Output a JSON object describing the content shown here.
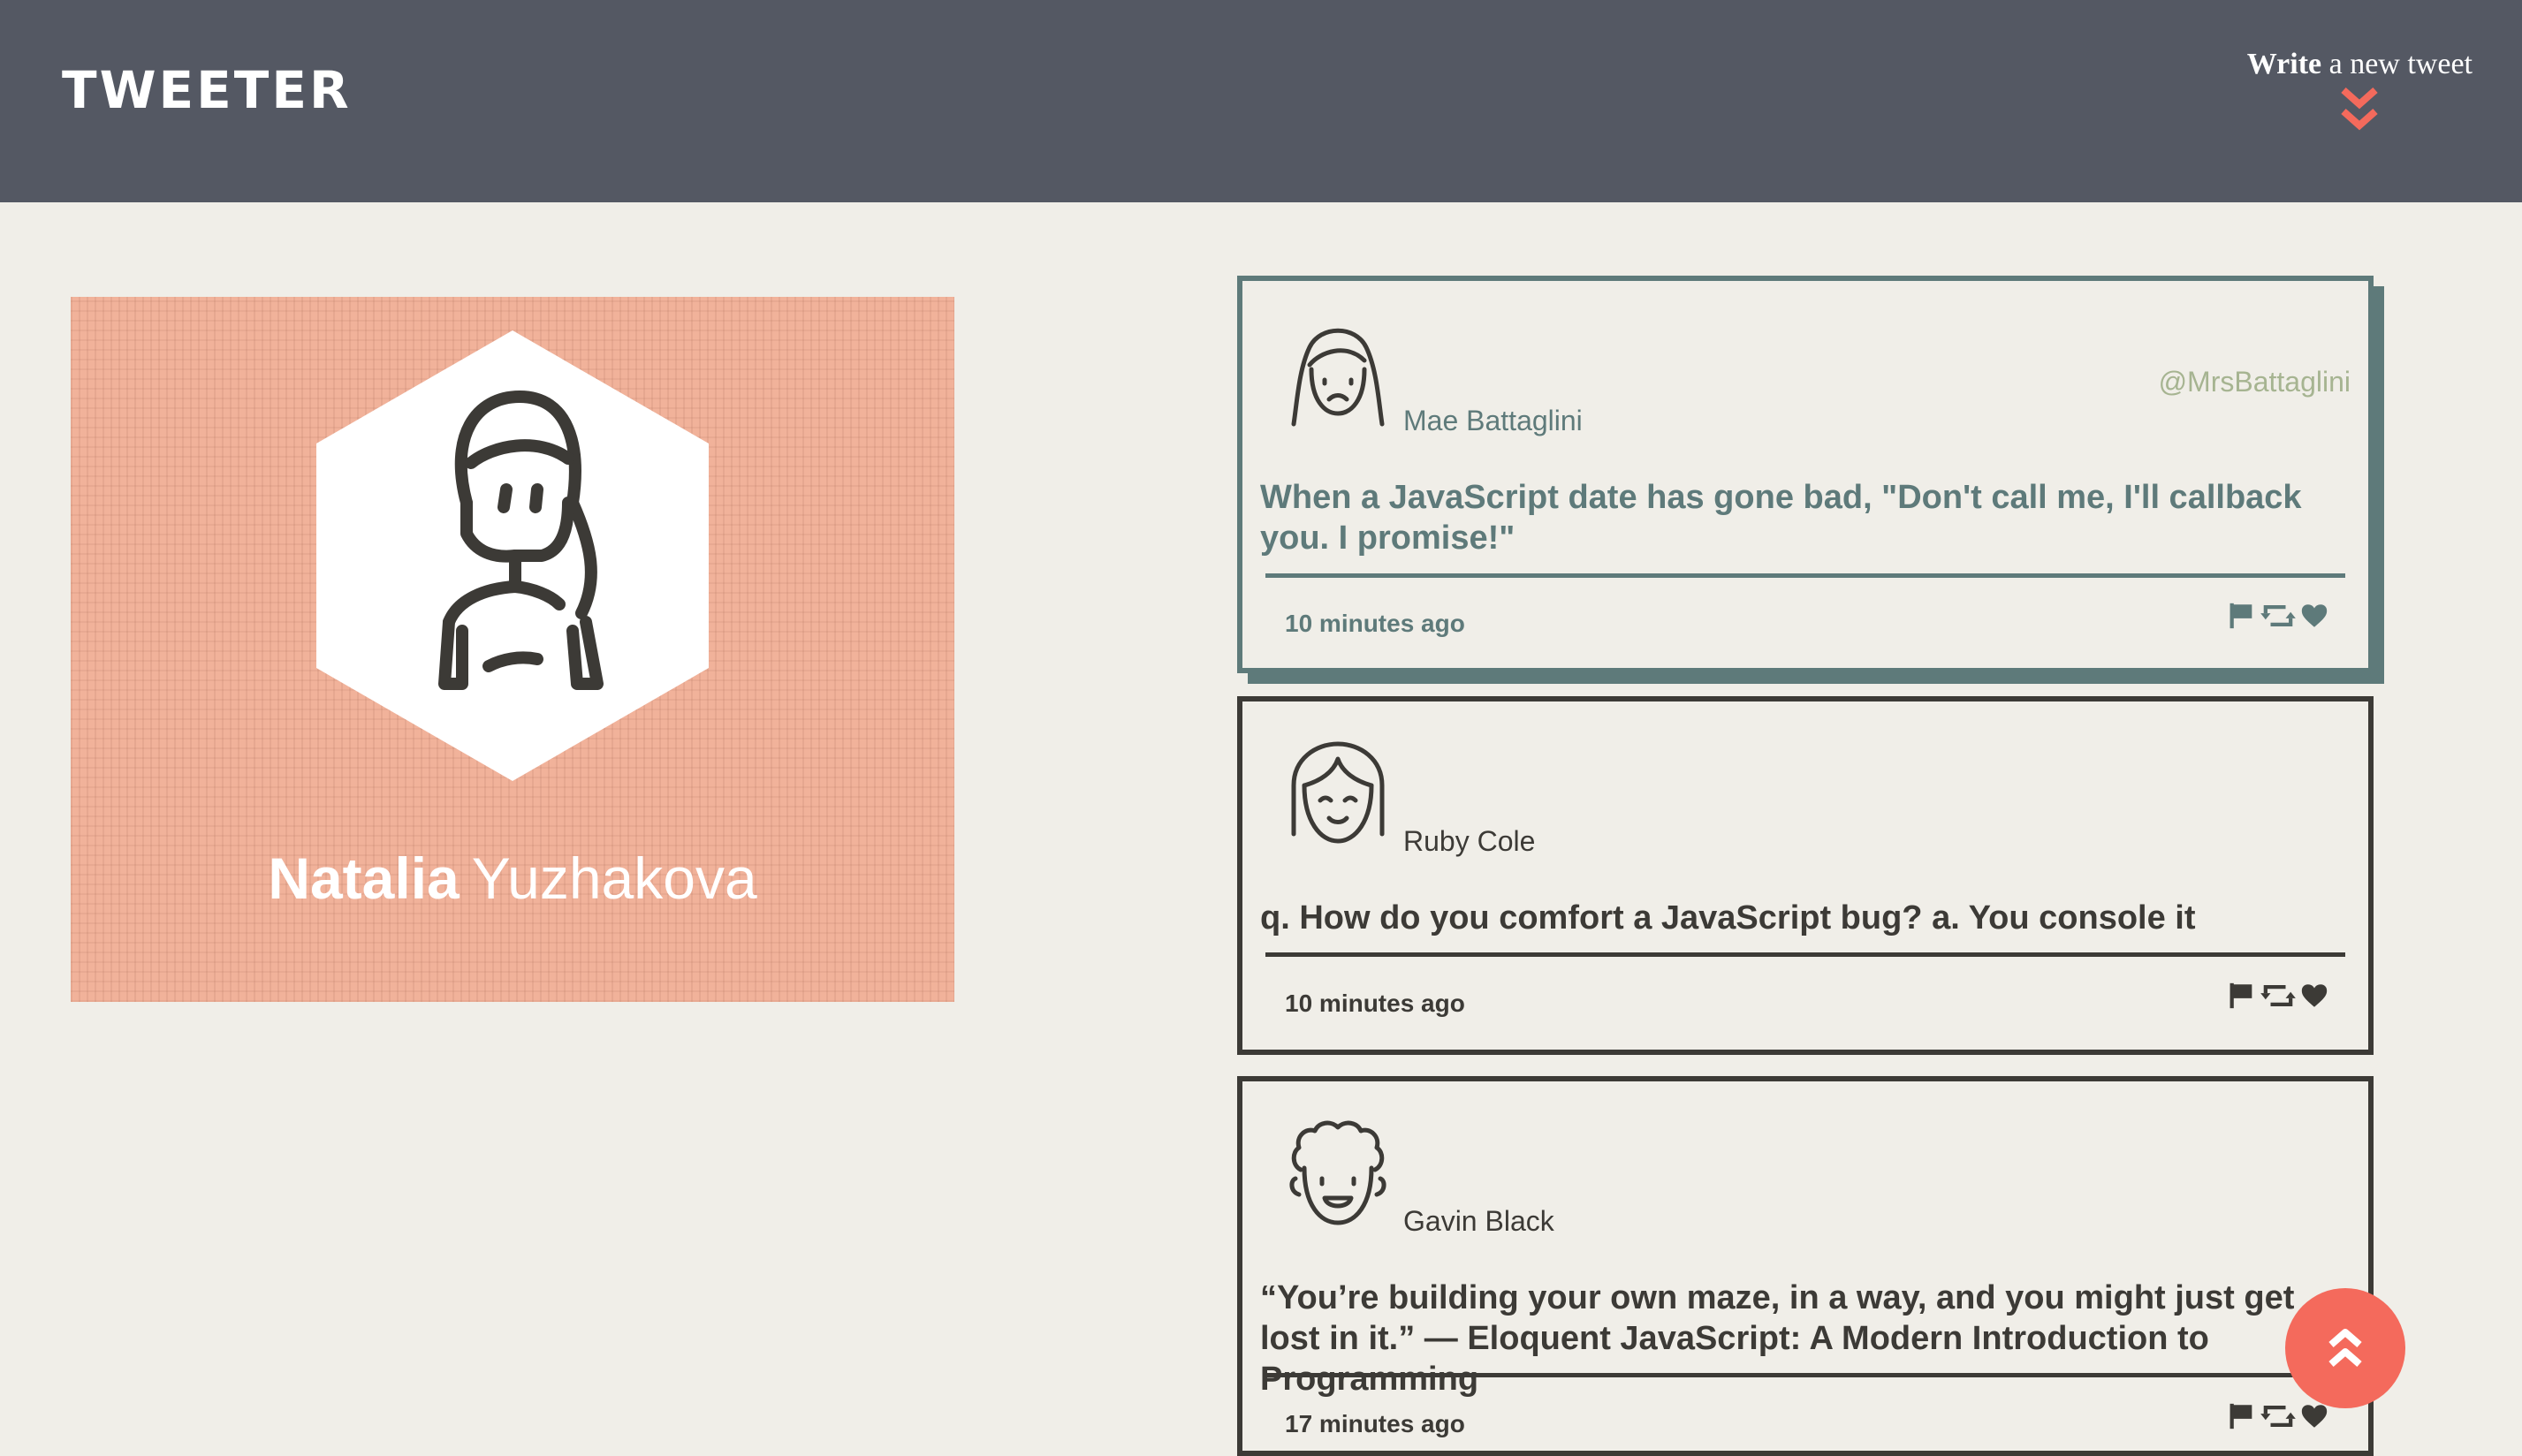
{
  "nav": {
    "brand": "TWEETER",
    "compose_bold": "Write",
    "compose_rest": "a new tweet"
  },
  "profile": {
    "first_name": "Natalia",
    "last_name": "Yuzhakova",
    "background_color": "#f1b29a"
  },
  "colors": {
    "nav": "#545863",
    "page": "#f0eee8",
    "dark": "#3c3a36",
    "highlight": "#5e7a7a",
    "handle": "#a6b491",
    "accent": "#f46a5c"
  },
  "tweets": [
    {
      "name": "Mae Battaglini",
      "handle": "@MrsBattaglini",
      "text": "When a JavaScript date has gone bad, \"Don't call me, I'll callback you. I promise!\"",
      "time": "10 minutes ago",
      "avatar_icon": "woman-avatar-icon"
    },
    {
      "name": "Ruby Cole",
      "text": "q. How do you comfort a JavaScript bug? a. You console it",
      "time": "10 minutes ago",
      "avatar_icon": "girl-avatar-icon"
    },
    {
      "name": "Gavin Black",
      "text": "“You’re building your own maze, in a way, and you might just get lost in it.” — Eloquent JavaScript: A Modern Introduction to Programming",
      "time": "17 minutes ago",
      "avatar_icon": "man-avatar-icon"
    }
  ]
}
